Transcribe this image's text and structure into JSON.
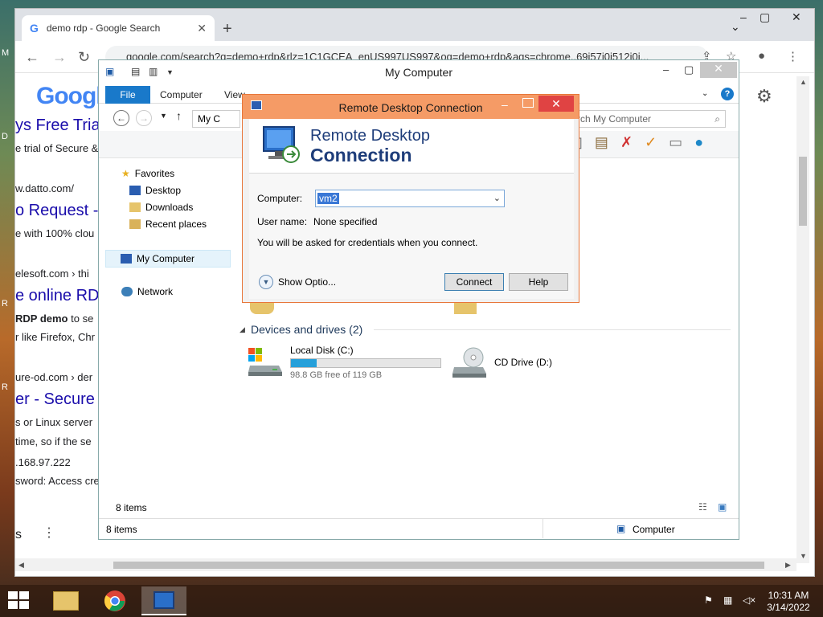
{
  "desktop": {
    "edge_letters": [
      "M",
      "D",
      "R",
      "R"
    ]
  },
  "chrome": {
    "tab_title": "demo rdp - Google Search",
    "tab_favicon": "G",
    "url": "google.com/search?q=demo+rdp&rlz=1C1GCEA_enUS997US997&oq=demo+rdp&aqs=chrome..69i57j0i512j0i...",
    "logo": "Googl",
    "results": [
      {
        "heading": "ys Free Trial",
        "snippet": "e trial of Secure &",
        "url": "w.datto.com/"
      },
      {
        "heading": "o Request -",
        "snippet": "e with 100% clou",
        "url": "elesoft.com › thi"
      },
      {
        "heading": "e online RDP",
        "snippet_bold": "RDP demo",
        "snippet_rest": " to se",
        "snippet2": "r like Firefox, Chr",
        "url": "ure-od.com › der"
      },
      {
        "heading": "er - Secure",
        "snippet": "s or Linux server",
        "snippet2": "time, so if the se",
        "ip": ".168.97.222",
        "password": "sword: Access cre"
      }
    ],
    "footer_fragment": "s"
  },
  "explorer": {
    "title": "My Computer",
    "ribbon_tabs": [
      "File",
      "Computer",
      "View"
    ],
    "address_fragment": "My C",
    "search_placeholder": "rch My Computer",
    "nav": {
      "favorites": "Favorites",
      "desktop": "Desktop",
      "downloads": "Downloads",
      "recent": "Recent places",
      "my_computer": "My Computer",
      "network": "Network"
    },
    "devices_header": "Devices and drives (2)",
    "drives": [
      {
        "name": "Local Disk (C:)",
        "free_text": "98.8 GB free of 119 GB",
        "used_fraction": 0.17
      },
      {
        "name": "CD Drive (D:)"
      }
    ],
    "items_count": "8 items",
    "status_items": "8 items",
    "status_location": "Computer"
  },
  "rdp": {
    "title": "Remote Desktop Connection",
    "banner_line1": "Remote Desktop",
    "banner_line2": "Connection",
    "computer_label": "Computer:",
    "computer_value": "vm2",
    "user_label": "User name:",
    "user_value": "None specified",
    "info_text": "You will be asked for credentials when you connect.",
    "show_options": "Show Optio...",
    "connect_label": "Connect",
    "help_label": "Help"
  },
  "taskbar": {
    "time": "10:31 AM",
    "date": "3/14/2022"
  },
  "colors": {
    "rdp_titlebar": "#f59b66",
    "rdp_close": "#e04343",
    "explorer_file_tab": "#1979ca",
    "link_blue": "#1a0dab"
  }
}
